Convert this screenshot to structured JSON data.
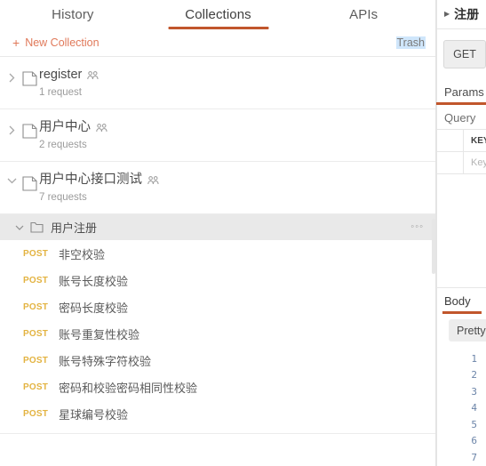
{
  "tabs": [
    {
      "label": "History",
      "active": false
    },
    {
      "label": "Collections",
      "active": true
    },
    {
      "label": "APIs",
      "active": false
    }
  ],
  "toolbar": {
    "new_collection_label": "New Collection",
    "plus_icon": "+",
    "trash_label": "Trash"
  },
  "collections": [
    {
      "name": "register",
      "requests_label": "1 request",
      "expanded": false
    },
    {
      "name": "用户中心",
      "requests_label": "2 requests",
      "expanded": false
    },
    {
      "name": "用户中心接口测试",
      "requests_label": "7 requests",
      "expanded": true
    }
  ],
  "subfolder": {
    "name": "用户注册",
    "expanded": true,
    "menu_label": "◦◦◦"
  },
  "requests": [
    {
      "method": "POST",
      "name": "非空校验"
    },
    {
      "method": "POST",
      "name": "账号长度校验"
    },
    {
      "method": "POST",
      "name": "密码长度校验"
    },
    {
      "method": "POST",
      "name": "账号重复性校验"
    },
    {
      "method": "POST",
      "name": "账号特殊字符校验"
    },
    {
      "method": "POST",
      "name": "密码和校验密码相同性校验"
    },
    {
      "method": "POST",
      "name": "星球编号校验"
    }
  ],
  "right_panel": {
    "request_tab_label": "注册",
    "method_label": "GET",
    "params_tab_label": "Params",
    "query_label": "Query",
    "table_header_key": "KEY",
    "table_row_key_placeholder": "Key",
    "body_tab_label": "Body",
    "pretty_button_label": "Pretty",
    "gutter_lines": [
      "1",
      "2",
      "3",
      "4",
      "5",
      "6",
      "7"
    ]
  },
  "colors": {
    "accent_underline": "#c1562c",
    "new_collection_text": "#e0795a",
    "method_post": "#e3b341",
    "selected_row_bg": "#e9e9e9",
    "gutter_number": "#6b84a8",
    "trash_highlight": "#cfe6fb"
  }
}
